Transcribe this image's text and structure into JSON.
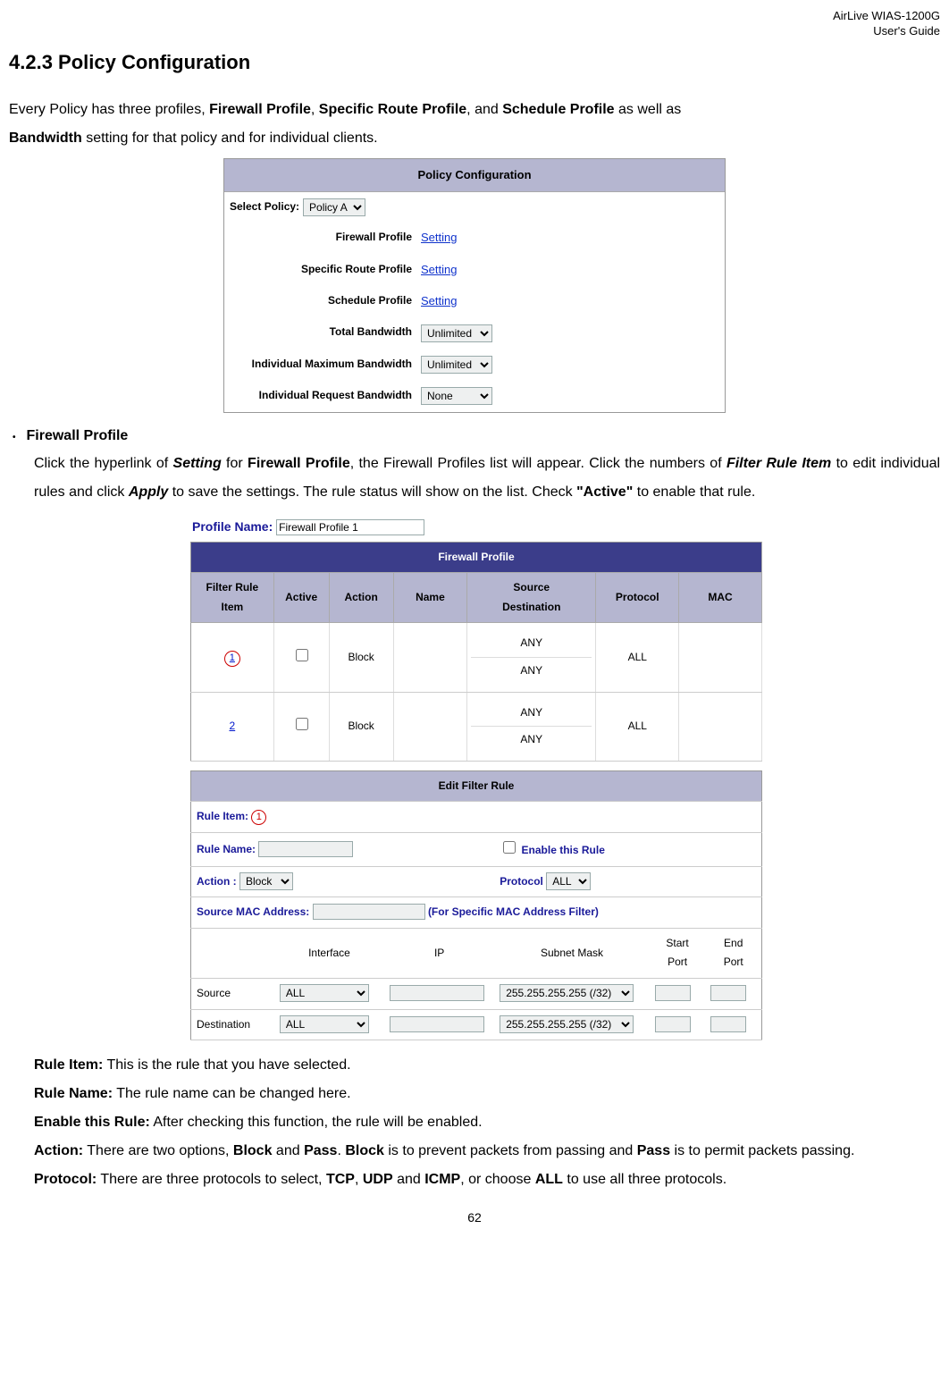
{
  "header": {
    "line1": "AirLive WIAS-1200G",
    "line2": "User's Guide"
  },
  "section_title": "4.2.3 Policy Configuration",
  "intro": {
    "p1a": "Every Policy has three profiles, ",
    "p1b": "Firewall Profile",
    "p1c": ", ",
    "p1d": "Specific Route Profile",
    "p1e": ", and ",
    "p1f": "Schedule Profile",
    "p1g": " as well as ",
    "p2a": "Bandwidth",
    "p2b": " setting for that policy and for individual clients."
  },
  "policy_panel": {
    "title": "Policy Configuration",
    "select_label": "Select Policy:",
    "select_value": "Policy A",
    "rows": [
      {
        "label": "Firewall Profile",
        "type": "link",
        "value": "Setting"
      },
      {
        "label": "Specific Route Profile",
        "type": "link",
        "value": "Setting"
      },
      {
        "label": "Schedule Profile",
        "type": "link",
        "value": "Setting"
      },
      {
        "label": "Total Bandwidth",
        "type": "select",
        "value": "Unlimited"
      },
      {
        "label": "Individual Maximum Bandwidth",
        "type": "select",
        "value": "Unlimited"
      },
      {
        "label": "Individual Request Bandwidth",
        "type": "select",
        "value": "None"
      }
    ]
  },
  "fw_bullet_title": "Firewall Profile",
  "fw_para": {
    "t1": "Click the hyperlink of ",
    "t2": "Setting",
    "t3": " for ",
    "t4": "Firewall Profile",
    "t5": ", the Firewall Profiles list will appear. Click the numbers of ",
    "t6": "Filter Rule Item",
    "t7": " to edit individual rules and click ",
    "t8": "Apply",
    "t9": " to save the settings. The rule status will show on the list. Check ",
    "t10": "\"Active\"",
    "t11": " to enable that rule."
  },
  "profile_name": {
    "label": "Profile Name:",
    "value": "Firewall Profile 1"
  },
  "fp_title": "Firewall Profile",
  "fp_headers": {
    "item": "Filter Rule Item",
    "active": "Active",
    "action": "Action",
    "name": "Name",
    "srcdst": "Source\nDestination",
    "protocol": "Protocol",
    "mac": "MAC"
  },
  "fp_rows": [
    {
      "item": "1",
      "circled": true,
      "action": "Block",
      "name": "",
      "src": "ANY",
      "dst": "ANY",
      "protocol": "ALL",
      "mac": ""
    },
    {
      "item": "2",
      "circled": false,
      "action": "Block",
      "name": "",
      "src": "ANY",
      "dst": "ANY",
      "protocol": "ALL",
      "mac": ""
    }
  ],
  "edit_title": "Edit Filter Rule",
  "edit": {
    "rule_item_label": "Rule Item:",
    "rule_item_val": "1",
    "rule_name_label": "Rule Name:",
    "enable_label": "Enable this Rule",
    "action_label": "Action :",
    "action_val": "Block",
    "protocol_label": "Protocol",
    "protocol_val": "ALL",
    "mac_label": "Source MAC Address:",
    "mac_note": "(For Specific MAC Address Filter)",
    "cols": {
      "interface": "Interface",
      "ip": "IP",
      "mask": "Subnet Mask",
      "sport": "Start\nPort",
      "eport": "End\nPort"
    },
    "src_label": "Source",
    "dst_label": "Destination",
    "if_val": "ALL",
    "mask_val": "255.255.255.255 (/32)"
  },
  "defs": {
    "rule_item_h": "Rule Item:",
    "rule_item_t": " This is the rule that you have selected.",
    "rule_name_h": "Rule Name:",
    "rule_name_t": " The rule name can be changed here.",
    "enable_h": "Enable this Rule:",
    "enable_t": " After checking this function, the rule will be enabled.",
    "action_h": "Action:",
    "action_t1": " There are two options, ",
    "action_t2": "Block",
    "action_t3": " and ",
    "action_t4": "Pass",
    "action_t5": ". ",
    "action_t6": "Block",
    "action_t7": " is to prevent packets from passing and ",
    "action_t8": "Pass",
    "action_t9": " is to permit packets passing.",
    "proto_h": "Protocol:",
    "proto_t1": " There are three protocols to select, ",
    "proto_t2": "TCP",
    "proto_t3": ", ",
    "proto_t4": "UDP",
    "proto_t5": " and ",
    "proto_t6": "ICMP",
    "proto_t7": ", or choose ",
    "proto_t8": "ALL",
    "proto_t9": " to use all three protocols."
  },
  "page_number": "62"
}
